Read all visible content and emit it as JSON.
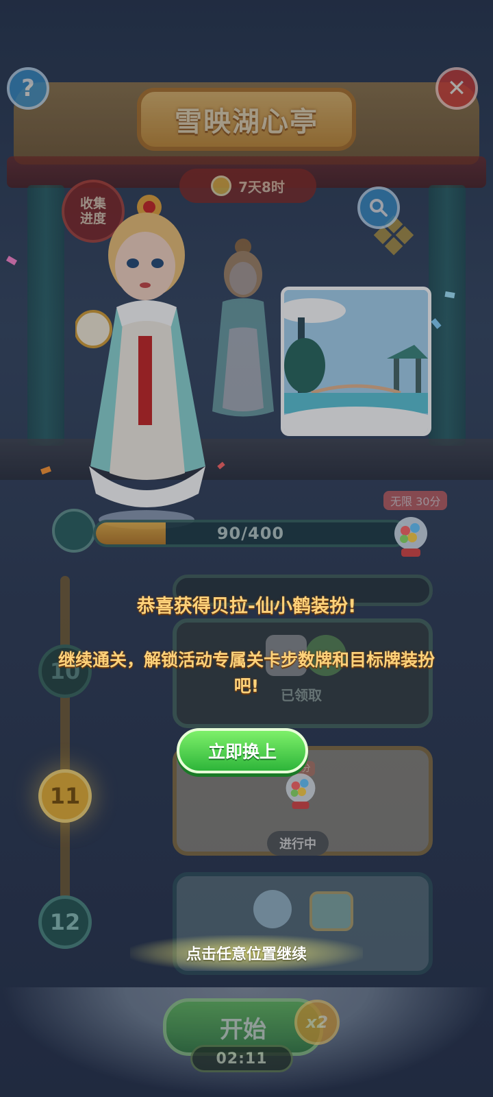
{
  "event": {
    "title": "雪映湖心亭",
    "time_left": "7天8时",
    "collect_progress_label": "收集进度"
  },
  "progress": {
    "current": 90,
    "max": 400,
    "label": "90/400",
    "reward_tag": "无限 30分"
  },
  "levels": [
    {
      "number": "10",
      "status": "已领取"
    },
    {
      "number": "11",
      "status": "进行中",
      "reward_tag": "30分"
    },
    {
      "number": "12"
    }
  ],
  "popup": {
    "title": "恭喜获得贝拉-仙小鹤装扮!",
    "description": "继续通关，解锁活动专属关卡步数牌和目标牌装扮吧!",
    "equip_button": "立即换上",
    "tap_hint": "点击任意位置继续"
  },
  "bottom": {
    "start_button": "开始",
    "multiplier": "x2",
    "countdown": "02:11"
  },
  "icons": {
    "help": "question-icon",
    "close": "close-icon",
    "search": "magnifier-icon",
    "clock": "clock-icon"
  },
  "colors": {
    "popup_text": "#ffd27a",
    "equip_button": "#3fcf45",
    "accent_gold": "#e8b23a"
  }
}
